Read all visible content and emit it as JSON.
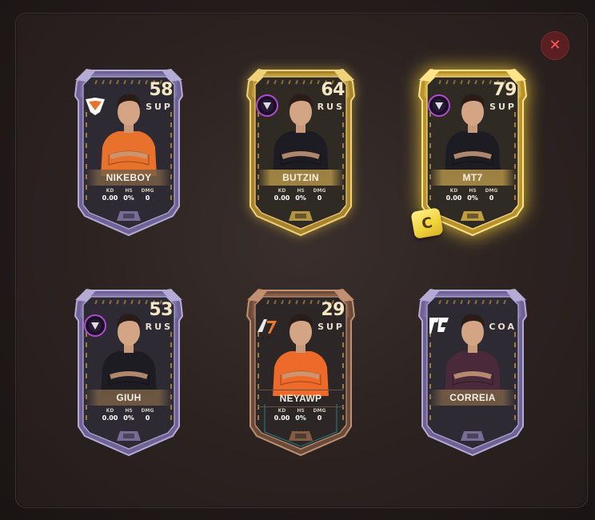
{
  "close_button": {
    "label": "✕"
  },
  "cards": [
    {
      "name": "NIKEBOY",
      "rating": "58",
      "position": "SUP",
      "tier": "silver",
      "team": "virtus-pro-logo",
      "kit": "#e8712b",
      "stats": {
        "kd_label": "KD",
        "kd": "0.00",
        "hs_label": "HS",
        "hs": "0%",
        "dmg_label": "DMG",
        "dmg": "0"
      }
    },
    {
      "name": "BUTZIN",
      "rating": "64",
      "position": "RUS",
      "tier": "gold",
      "team": "purple-team-logo",
      "kit": "#1c1c22",
      "stats": {
        "kd_label": "KD",
        "kd": "0.00",
        "hs_label": "HS",
        "hs": "0%",
        "dmg_label": "DMG",
        "dmg": "0"
      }
    },
    {
      "name": "MT7",
      "rating": "79",
      "position": "SUP",
      "tier": "gold-glow",
      "team": "purple-team-logo",
      "kit": "#1c1c22",
      "stats": {
        "kd_label": "KD",
        "kd": "0.00",
        "hs_label": "HS",
        "hs": "0%",
        "dmg_label": "DMG",
        "dmg": "0"
      }
    },
    {
      "name": "GIUH",
      "rating": "53",
      "position": "RUS",
      "tier": "silver",
      "team": "purple-team-logo",
      "kit": "#1c1c22",
      "stats": {
        "kd_label": "KD",
        "kd": "0.00",
        "hs_label": "HS",
        "hs": "0%",
        "dmg_label": "DMG",
        "dmg": "0"
      }
    },
    {
      "name": "NEYAWP",
      "rating": "29",
      "position": "SUP",
      "tier": "bronze",
      "team": "a7-logo",
      "kit": "#ee6a2a",
      "stats": {
        "kd_label": "KD",
        "kd": "0.00",
        "hs_label": "HS",
        "hs": "0%",
        "dmg_label": "DMG",
        "dmg": "0"
      }
    },
    {
      "name": "CORREIA",
      "rating": "",
      "position": "COA",
      "tier": "silver",
      "team": "tf-logo",
      "kit": "#4a2a3a",
      "stats": null
    }
  ],
  "chip": {
    "label": "C"
  },
  "colors": {
    "silver_frame": "#8a7cb0",
    "gold_frame": "#d4af4a",
    "bronze_frame": "#9a6a4a",
    "close_accent": "#ff5a5a"
  }
}
